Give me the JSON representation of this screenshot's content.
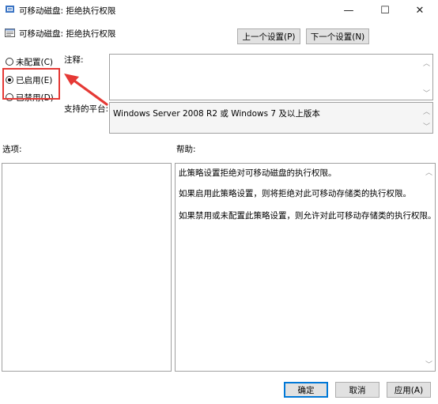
{
  "window": {
    "title": "可移动磁盘: 拒绝执行权限",
    "minimize_glyph": "—",
    "maximize_glyph": "☐",
    "close_glyph": "✕"
  },
  "header": {
    "policy_name": "可移动磁盘: 拒绝执行权限",
    "prev_setting_label": "上一个设置(P)",
    "next_setting_label": "下一个设置(N)"
  },
  "options": {
    "not_configured": "未配置(C)",
    "enabled": "已启用(E)",
    "disabled": "已禁用(D)",
    "selected": "enabled"
  },
  "comment": {
    "label": "注释:",
    "value": ""
  },
  "platform": {
    "label": "支持的平台:",
    "value": "Windows Server 2008 R2 或 Windows 7 及以上版本"
  },
  "sections": {
    "options_label": "选项:",
    "help_label": "帮助:"
  },
  "help": {
    "paragraphs": [
      "此策略设置拒绝对可移动磁盘的执行权限。",
      "如果启用此策略设置，则将拒绝对此可移动存储类的执行权限。",
      "如果禁用或未配置此策略设置，则允许对此可移动存储类的执行权限。"
    ]
  },
  "footer": {
    "ok_label": "确定",
    "cancel_label": "取消",
    "apply_label": "应用(A)"
  },
  "annotation": {
    "highlight_color": "#e53935"
  }
}
